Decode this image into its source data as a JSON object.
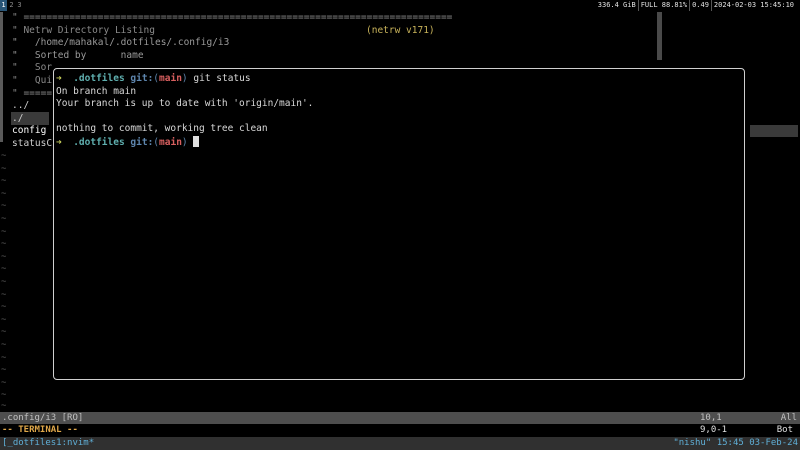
{
  "topbar": {
    "workspaces": [
      "1",
      "2",
      "3"
    ],
    "active_workspace": "1",
    "status": {
      "disk": "336.4 GiB",
      "battery": "FULL 88.81%",
      "load": "0.49",
      "datetime": "2024-02-03 15:45:10"
    }
  },
  "netrw": {
    "separator": "\" ===========================================================================",
    "title": "\" Netrw Directory Listing",
    "version": "(netrw v171)",
    "path": "\"   /home/mahakal/.dotfiles/.config/i3",
    "sorted_by_label": "\"   Sorted by      name",
    "sort_seq_partial": "\"   Sor",
    "quick_help_partial": "\"   Qui",
    "separator_partial": "\" =====",
    "entries": [
      "../",
      "./",
      "config",
      "statusC"
    ],
    "selected_entry": "config",
    "empty_line_marker": "~"
  },
  "terminal": {
    "prompt_arrow": "➜",
    "prompt_dir": ".dotfiles",
    "prompt_git": "git:",
    "prompt_branch": "main",
    "command": "git status",
    "output": [
      "On branch main",
      "Your branch is up to date with 'origin/main'.",
      "",
      "nothing to commit, working tree clean"
    ]
  },
  "statusline": {
    "file": ".config/i3 [RO]",
    "position": "10,1",
    "scroll": "All"
  },
  "modeline": {
    "mode": "-- TERMINAL --",
    "position": "9,0-1",
    "scroll": "Bot"
  },
  "tmux": {
    "session": "[_dotfiles1:nvim*",
    "host": "\"nishu\"",
    "time": "15:45",
    "date": "03-Feb-24"
  }
}
